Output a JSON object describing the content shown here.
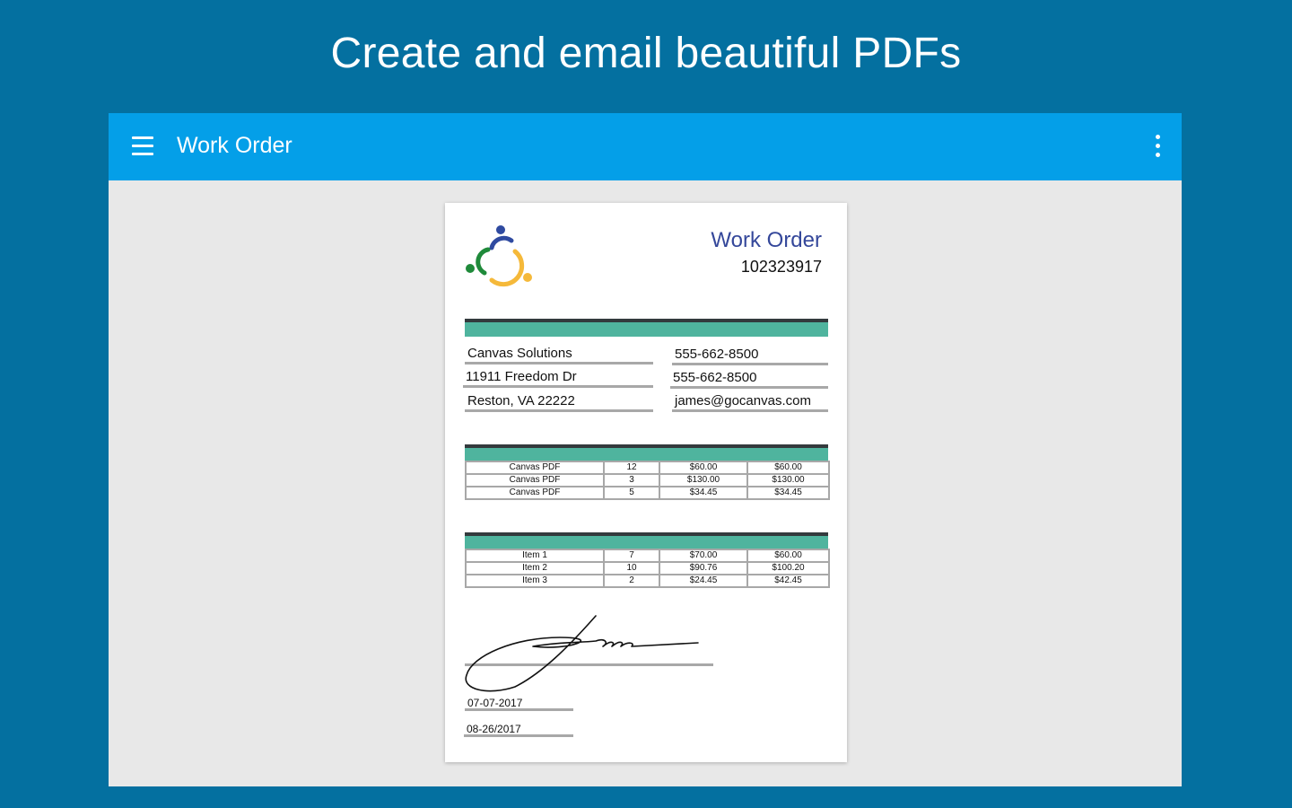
{
  "headline": "Create and email beautiful PDFs",
  "appbar": {
    "title": "Work Order",
    "menu_icon": "hamburger-menu-icon",
    "more_icon": "more-vert-icon",
    "color": "#049fe8"
  },
  "document": {
    "title": "Work Order",
    "number": "102323917",
    "accent_color": "#4fb49e",
    "title_color": "#34479a",
    "company": {
      "name": "Canvas Solutions",
      "address": "11911 Freedom Dr",
      "city": "Reston, VA 22222",
      "phone1": "555-662-8500",
      "phone2": "555-662-8500",
      "email": "james@gocanvas.com"
    },
    "table1": [
      [
        "Canvas PDF",
        "12",
        "$60.00",
        "$60.00"
      ],
      [
        "Canvas PDF",
        "3",
        "$130.00",
        "$130.00"
      ],
      [
        "Canvas PDF",
        "5",
        "$34.45",
        "$34.45"
      ]
    ],
    "table2": [
      [
        "Item 1",
        "7",
        "$70.00",
        "$60.00"
      ],
      [
        "Item 2",
        "10",
        "$90.76",
        "$100.20"
      ],
      [
        "Item 3",
        "2",
        "$24.45",
        "$42.45"
      ]
    ],
    "date1": "07-07-2017",
    "date2": "08-26/2017"
  },
  "background_color": "#0470a0"
}
